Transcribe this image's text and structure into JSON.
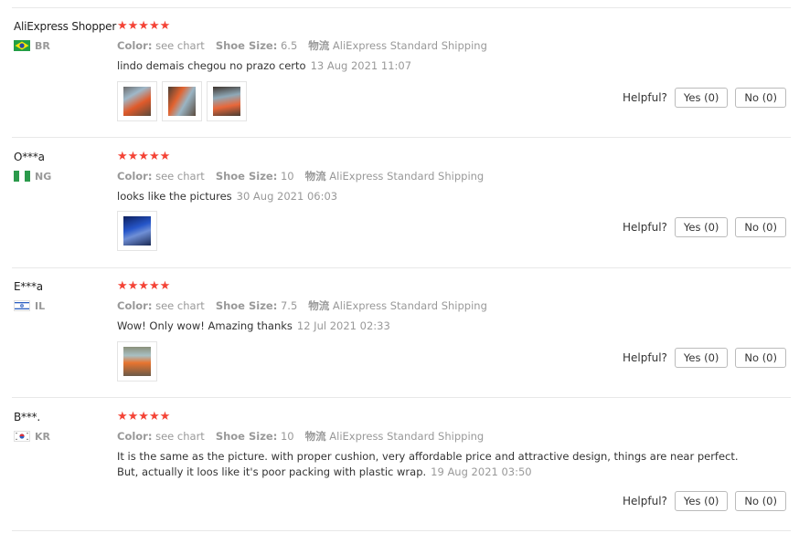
{
  "labels": {
    "color": "Color:",
    "shoe_size": "Shoe Size:",
    "logistics": "物流",
    "helpful": "Helpful?"
  },
  "reviews": [
    {
      "user": "AliExpress Shopper",
      "country": "BR",
      "flag": "flag-brazil-icon",
      "stars": "★★★★★",
      "rating": 5,
      "color": "see chart",
      "shoe_size": "6.5",
      "shipping": "AliExpress Standard Shipping",
      "text": "lindo demais chegou no prazo certo",
      "date": "13 Aug 2021 11:07",
      "yes": "Yes (0)",
      "no": "No (0)"
    },
    {
      "user": "O***a",
      "country": "NG",
      "flag": "flag-nigeria-icon",
      "stars": "★★★★★",
      "rating": 5,
      "color": "see chart",
      "shoe_size": "10",
      "shipping": "AliExpress Standard Shipping",
      "text": "looks like the pictures",
      "date": "30 Aug 2021 06:03",
      "yes": "Yes (0)",
      "no": "No (0)"
    },
    {
      "user": "E***a",
      "country": "IL",
      "flag": "flag-israel-icon",
      "stars": "★★★★★",
      "rating": 5,
      "color": "see chart",
      "shoe_size": "7.5",
      "shipping": "AliExpress Standard Shipping",
      "text": "Wow! Only wow! Amazing thanks",
      "date": "12 Jul 2021 02:33",
      "yes": "Yes (0)",
      "no": "No (0)"
    },
    {
      "user": "B***.",
      "country": "KR",
      "flag": "flag-south-korea-icon",
      "stars": "★★★★★",
      "rating": 5,
      "color": "see chart",
      "shoe_size": "10",
      "shipping": "AliExpress Standard Shipping",
      "text_line1": "It is the same as the picture. with proper cushion, very affordable price and attractive design, things are near perfect.",
      "text_line2": "But, actually it loos like it's poor packing with plastic wrap.",
      "date": "19 Aug 2021 03:50",
      "yes": "Yes (0)",
      "no": "No (0)"
    }
  ],
  "colors": {
    "star": "#f44336",
    "muted": "#999999",
    "divider": "#e8e8e8"
  }
}
